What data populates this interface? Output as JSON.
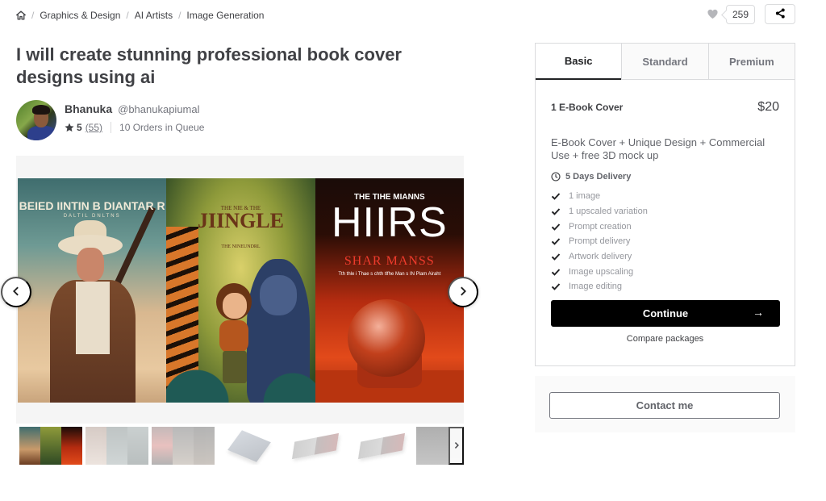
{
  "breadcrumb": {
    "home_icon": "home-icon",
    "items": [
      "Graphics & Design",
      "AI Artists",
      "Image Generation"
    ]
  },
  "actions": {
    "likes_count": "259",
    "heart_icon": "heart-icon",
    "share_icon": "share-icon"
  },
  "gig": {
    "title": "I will create stunning professional book cover designs using ai"
  },
  "seller": {
    "name": "Bhanuka",
    "handle": "@bhanukapiumal",
    "rating": "5",
    "reviews": "(55)",
    "queue": "10 Orders in Queue"
  },
  "gallery": {
    "covers": [
      {
        "title": "BEIED IINTIN B DIANTAR R",
        "subtitle": "DALTIL   DNLTNS"
      },
      {
        "small": "THE NIE & THE",
        "title": "JIINGLE",
        "subtitle": "THE NINEUNDRL"
      },
      {
        "small": "THE TIHE MIANNS",
        "title": "HIIRS",
        "red": "SHAR MANSS",
        "line": "Tth thle i Thae s chth tlfhe Man s IN Plam Airaht"
      }
    ],
    "prev_icon": "chevron-left-icon",
    "next_icon": "chevron-right-icon",
    "thumbnail_count": 7
  },
  "package": {
    "tabs": [
      "Basic",
      "Standard",
      "Premium"
    ],
    "active_tab": "Basic",
    "name": "1 E-Book Cover",
    "price": "$20",
    "description": "E-Book Cover + Unique Design + Commercial Use + free 3D mock up",
    "delivery": "5 Days Delivery",
    "features": [
      "1 image",
      "1 upscaled variation",
      "Prompt creation",
      "Prompt delivery",
      "Artwork delivery",
      "Image upscaling",
      "Image editing"
    ],
    "continue_label": "Continue",
    "continue_arrow": "→",
    "compare_label": "Compare packages"
  },
  "contact": {
    "label": "Contact me"
  },
  "colors": {
    "text": "#404145",
    "muted": "#74767e",
    "border": "#dadbdd",
    "primary_button": "#000000"
  }
}
